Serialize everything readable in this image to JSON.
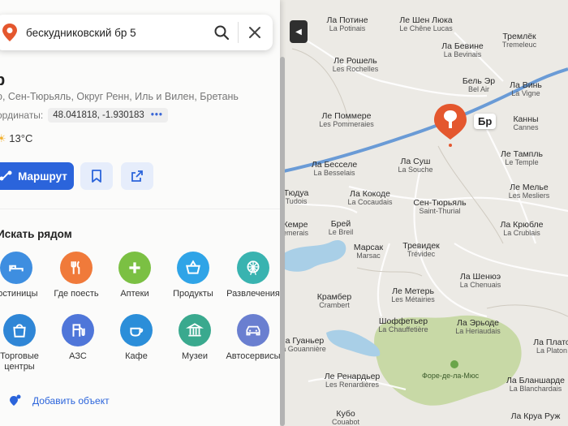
{
  "search": {
    "query": "бескудниковский бр 5"
  },
  "place": {
    "title": "р",
    "address": "о, Сен-Тюрьяль, Округ Ренн, Иль и Вилен, Бретань",
    "coords_label": "ординаты:",
    "coords_value": "48.041818, -1.930183",
    "weather": "13°C"
  },
  "actions": {
    "route_label": "Маршрут"
  },
  "nearby": {
    "title": "Искать рядом",
    "categories": [
      {
        "label": "гостиницы",
        "icon": "bed-icon",
        "color": "#3e8ee0"
      },
      {
        "label": "Где поесть",
        "icon": "fork-knife-icon",
        "color": "#f07a3a"
      },
      {
        "label": "Аптеки",
        "icon": "plus-icon",
        "color": "#7bc043"
      },
      {
        "label": "Продукты",
        "icon": "basket-icon",
        "color": "#2fa4e7"
      },
      {
        "label": "Развлечения",
        "icon": "ferris-wheel-icon",
        "color": "#39b3b0"
      },
      {
        "label": "Торговые центры",
        "icon": "shopping-bag-icon",
        "color": "#2f86d6"
      },
      {
        "label": "АЗС",
        "icon": "fuel-icon",
        "color": "#4f76d9"
      },
      {
        "label": "Кафе",
        "icon": "coffee-icon",
        "color": "#2b8ed9"
      },
      {
        "label": "Музеи",
        "icon": "museum-icon",
        "color": "#3aa98e"
      },
      {
        "label": "Автосервисы",
        "icon": "car-icon",
        "color": "#6a7fd0"
      }
    ]
  },
  "add_object_label": "Добавить объект",
  "map": {
    "pin_label": "Бр",
    "park_label": "Форе-де-ла-Мюс",
    "places": [
      {
        "ru": "Ла Потине",
        "fr": "La Potinais"
      },
      {
        "ru": "Ле Шен Люка",
        "fr": "Le Chêne Lucas"
      },
      {
        "ru": "Ла Бевине",
        "fr": "La Bevinais"
      },
      {
        "ru": "Тремлёк",
        "fr": "Tremeleuc"
      },
      {
        "ru": "Ле Рошель",
        "fr": "Les Rochelles"
      },
      {
        "ru": "Бель Эр",
        "fr": "Bel Air"
      },
      {
        "ru": "Ла Винь",
        "fr": "La Vigne"
      },
      {
        "ru": "Ле Поммере",
        "fr": "Les Pommeraies"
      },
      {
        "ru": "Канны",
        "fr": "Cannes"
      },
      {
        "ru": "Ла Бесселе",
        "fr": "La Besselais"
      },
      {
        "ru": "Ла Суш",
        "fr": "La Souche"
      },
      {
        "ru": "Ле Тампль",
        "fr": "Le Temple"
      },
      {
        "ru": "Тюдуа",
        "fr": "Tudois"
      },
      {
        "ru": "Ла Кокоде",
        "fr": "La Cocaudais"
      },
      {
        "ru": "Ле Мелье",
        "fr": "Les Mesliers"
      },
      {
        "ru": "Сен-Тюрьяль",
        "fr": "Saint-Thurial"
      },
      {
        "ru": "Брей",
        "fr": "Le Breil"
      },
      {
        "ru": "Кемре",
        "fr": "emerais"
      },
      {
        "ru": "Ла Крюбле",
        "fr": "La Crublais"
      },
      {
        "ru": "Марсак",
        "fr": "Marsac"
      },
      {
        "ru": "Тревидек",
        "fr": "Trévidec"
      },
      {
        "ru": "Ла Шенюэ",
        "fr": "La Chenuais"
      },
      {
        "ru": "Ле Метерь",
        "fr": "Les Métairies"
      },
      {
        "ru": "Крамбер",
        "fr": "Crambert"
      },
      {
        "ru": "Шоффетьер",
        "fr": "La Chauffetière"
      },
      {
        "ru": "Ла Эрьоде",
        "fr": "La Heriaudais"
      },
      {
        "ru": "Ла Гуаньер",
        "fr": "La Gouannière"
      },
      {
        "ru": "Ле Ренардьер",
        "fr": "Les Renardières"
      },
      {
        "ru": "Ла Бланшарде",
        "fr": "La Blanchardais"
      },
      {
        "ru": "Кубо",
        "fr": "Couabot"
      },
      {
        "ru": "Ла Плато",
        "fr": "La Platon"
      },
      {
        "ru": "Ла Круа Руж",
        "fr": ""
      }
    ]
  }
}
